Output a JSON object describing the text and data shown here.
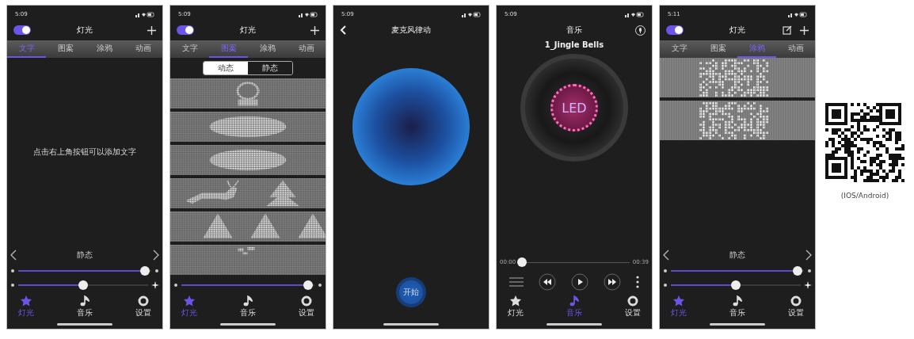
{
  "phones": [
    {
      "kind": "text",
      "time": "5:09",
      "title": "灯光",
      "power": {
        "on": true
      },
      "tabs": [
        {
          "label": "文字",
          "selected": true
        },
        {
          "label": "图案",
          "selected": false
        },
        {
          "label": "涂鸦",
          "selected": false
        },
        {
          "label": "动画",
          "selected": false
        }
      ],
      "message": "点击右上角按钮可以添加文字",
      "mode": "静态",
      "sliders": [
        {
          "level": 0.95
        },
        {
          "level": 0.5
        }
      ],
      "nav": [
        {
          "label": "灯光",
          "selected": true
        },
        {
          "label": "音乐",
          "selected": false
        },
        {
          "label": "设置",
          "selected": false
        }
      ]
    },
    {
      "kind": "pattern",
      "time": "5:09",
      "title": "灯光",
      "power": {
        "on": true
      },
      "tabs": [
        {
          "label": "文字",
          "selected": false
        },
        {
          "label": "图案",
          "selected": true
        },
        {
          "label": "涂鸦",
          "selected": false
        },
        {
          "label": "动画",
          "selected": false
        }
      ],
      "segments": [
        {
          "label": "动态",
          "selected": true
        },
        {
          "label": "静态",
          "selected": false
        }
      ],
      "sliders": [
        {
          "level": 0.95
        }
      ],
      "nav": [
        {
          "label": "灯光",
          "selected": true
        },
        {
          "label": "音乐",
          "selected": false
        },
        {
          "label": "设置",
          "selected": false
        }
      ]
    },
    {
      "kind": "mic",
      "time": "5:09",
      "title": "麦克风律动",
      "button": "开始"
    },
    {
      "kind": "music",
      "time": "5:09",
      "title": "音乐",
      "song": "1_Jingle Bells",
      "disc_label": "LED",
      "elapsed": "00:00",
      "duration": "00:39",
      "progress": {
        "level": 0.03
      },
      "nav": [
        {
          "label": "灯光",
          "selected": false
        },
        {
          "label": "音乐",
          "selected": true
        },
        {
          "label": "设置",
          "selected": false
        }
      ]
    },
    {
      "kind": "graffiti",
      "time": "5:11",
      "title": "灯光",
      "power": {
        "on": true
      },
      "tabs": [
        {
          "label": "文字",
          "selected": false
        },
        {
          "label": "图案",
          "selected": false
        },
        {
          "label": "涂鸦",
          "selected": true
        },
        {
          "label": "动画",
          "selected": false
        }
      ],
      "mode": "静态",
      "sliders": [
        {
          "level": 0.95
        },
        {
          "level": 0.5
        }
      ],
      "nav": [
        {
          "label": "灯光",
          "selected": true
        },
        {
          "label": "音乐",
          "selected": false
        },
        {
          "label": "设置",
          "selected": false
        }
      ]
    }
  ],
  "qr": {
    "caption": "(IOS/Android)"
  }
}
